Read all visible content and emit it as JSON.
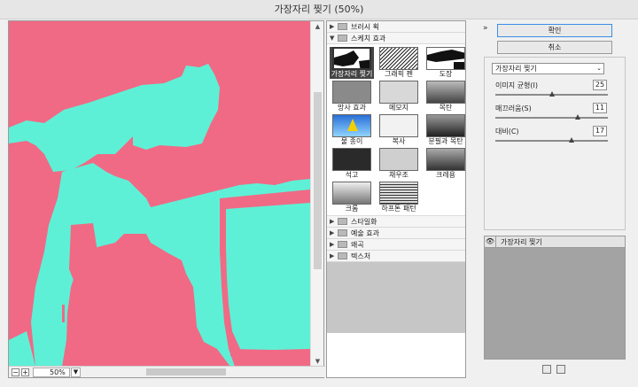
{
  "window": {
    "title": "가장자리 찢기 (50%)"
  },
  "preview": {
    "zoom": "50%",
    "zoom_out": "−",
    "zoom_in": "+",
    "zoom_dropdown": "▼"
  },
  "gallery": {
    "categories_top": [
      {
        "label": "브러시 획",
        "expanded": false
      }
    ],
    "sketch": {
      "label": "스케치 효과",
      "expanded": true,
      "filters": [
        {
          "label": "가장자리 찢기",
          "selected": true
        },
        {
          "label": "그래픽 펜",
          "selected": false
        },
        {
          "label": "도장",
          "selected": false
        },
        {
          "label": "망사 효과",
          "selected": false
        },
        {
          "label": "메모지",
          "selected": false
        },
        {
          "label": "목탄",
          "selected": false
        },
        {
          "label": "물 종이",
          "selected": false
        },
        {
          "label": "복사",
          "selected": false
        },
        {
          "label": "분필과 목탄",
          "selected": false
        },
        {
          "label": "석고",
          "selected": false
        },
        {
          "label": "채우조",
          "selected": false
        },
        {
          "label": "크레용",
          "selected": false
        },
        {
          "label": "크롬",
          "selected": false
        },
        {
          "label": "하프톤 패턴",
          "selected": false
        }
      ]
    },
    "categories_bottom": [
      {
        "label": "스타일화",
        "expanded": false
      },
      {
        "label": "예술 효과",
        "expanded": false
      },
      {
        "label": "왜곡",
        "expanded": false
      },
      {
        "label": "텍스처",
        "expanded": false
      }
    ]
  },
  "buttons": {
    "ok": "확인",
    "cancel": "취소",
    "collapse": "»"
  },
  "settings": {
    "filter_select": "가장자리 찢기",
    "params": [
      {
        "label": "이미지 균형(I)",
        "value": "25",
        "fraction": 0.5
      },
      {
        "label": "매끄러움(S)",
        "value": "11",
        "fraction": 0.73
      },
      {
        "label": "대비(C)",
        "value": "17",
        "fraction": 0.68
      }
    ]
  },
  "layers": {
    "items": [
      {
        "name": "가장자리 찢기",
        "visible": true
      }
    ]
  },
  "colors": {
    "pink": "#f06a85",
    "cyan": "#5ef0d6",
    "accent": "#3a8ee6"
  }
}
